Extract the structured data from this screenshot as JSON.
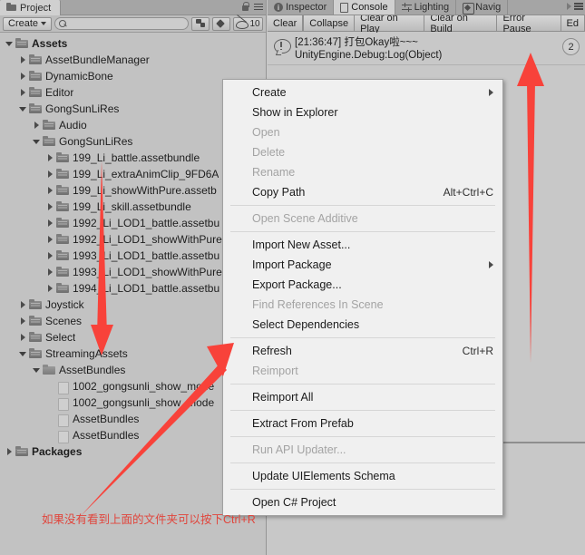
{
  "project_panel": {
    "tab_label": "Project",
    "tab_icon": "folder-icon",
    "lock_icon": "lock-icon",
    "menu_icon": "hamburger-menu-icon",
    "toolbar": {
      "create_label": "Create",
      "create_dropdown_icon": "chevron-down-icon",
      "search_icon": "search-icon",
      "search_value": "",
      "search_placeholder": "",
      "assetbundle_icon": "assetbundle-filter-icon",
      "label_icon": "label-filter-icon",
      "visibility_icon": "hidden-eye-icon",
      "visibility_count": "10"
    },
    "tree": [
      {
        "label": "Assets",
        "indent": 0,
        "expander": "down",
        "icon": "folder",
        "bold": true
      },
      {
        "label": "AssetBundleManager",
        "indent": 1,
        "expander": "right",
        "icon": "folder",
        "bold": false
      },
      {
        "label": "DynamicBone",
        "indent": 1,
        "expander": "right",
        "icon": "folder",
        "bold": false
      },
      {
        "label": "Editor",
        "indent": 1,
        "expander": "right",
        "icon": "folder",
        "bold": false
      },
      {
        "label": "GongSunLiRes",
        "indent": 1,
        "expander": "down",
        "icon": "folder",
        "bold": false
      },
      {
        "label": "Audio",
        "indent": 2,
        "expander": "right",
        "icon": "folder",
        "bold": false
      },
      {
        "label": "GongSunLiRes",
        "indent": 2,
        "expander": "down",
        "icon": "folder",
        "bold": false
      },
      {
        "label": "199_Li_battle.assetbundle",
        "indent": 3,
        "expander": "right",
        "icon": "folder",
        "bold": false
      },
      {
        "label": "199_Li_extraAnimClip_9FD6A",
        "indent": 3,
        "expander": "right",
        "icon": "folder",
        "bold": false
      },
      {
        "label": "199_Li_showWithPure.assetb",
        "indent": 3,
        "expander": "right",
        "icon": "folder",
        "bold": false
      },
      {
        "label": "199_Li_skill.assetbundle",
        "indent": 3,
        "expander": "right",
        "icon": "folder",
        "bold": false
      },
      {
        "label": "1992_Li_LOD1_battle.assetbu",
        "indent": 3,
        "expander": "right",
        "icon": "folder",
        "bold": false
      },
      {
        "label": "1992_Li_LOD1_showWithPure",
        "indent": 3,
        "expander": "right",
        "icon": "folder",
        "bold": false
      },
      {
        "label": "1993_Li_LOD1_battle.assetbu",
        "indent": 3,
        "expander": "right",
        "icon": "folder",
        "bold": false
      },
      {
        "label": "1993_Li_LOD1_showWithPure",
        "indent": 3,
        "expander": "right",
        "icon": "folder",
        "bold": false
      },
      {
        "label": "1994_Li_LOD1_battle.assetbu",
        "indent": 3,
        "expander": "right",
        "icon": "folder",
        "bold": false
      },
      {
        "label": "Joystick",
        "indent": 1,
        "expander": "right",
        "icon": "folder",
        "bold": false
      },
      {
        "label": "Scenes",
        "indent": 1,
        "expander": "right",
        "icon": "folder",
        "bold": false
      },
      {
        "label": "Select",
        "indent": 1,
        "expander": "right",
        "icon": "folder",
        "bold": false
      },
      {
        "label": "StreamingAssets",
        "indent": 1,
        "expander": "down",
        "icon": "folder",
        "bold": false
      },
      {
        "label": "AssetBundles",
        "indent": 2,
        "expander": "down",
        "icon": "folder-open",
        "bold": false
      },
      {
        "label": "1002_gongsunli_show_mode",
        "indent": 3,
        "expander": "none",
        "icon": "file",
        "bold": false
      },
      {
        "label": "1002_gongsunli_show_mode",
        "indent": 3,
        "expander": "none",
        "icon": "file",
        "bold": false
      },
      {
        "label": "AssetBundles",
        "indent": 3,
        "expander": "none",
        "icon": "file",
        "bold": false
      },
      {
        "label": "AssetBundles",
        "indent": 3,
        "expander": "none",
        "icon": "file",
        "bold": false
      },
      {
        "label": "Packages",
        "indent": 0,
        "expander": "right",
        "icon": "folder",
        "bold": true
      }
    ]
  },
  "console_panel": {
    "tabs": [
      {
        "label": "Inspector",
        "icon": "info-icon",
        "active": false
      },
      {
        "label": "Console",
        "icon": "console-doc-icon",
        "active": true
      },
      {
        "label": "Lighting",
        "icon": "lighting-sliders-icon",
        "active": false
      },
      {
        "label": "Navig",
        "icon": "navigation-icon",
        "active": false
      }
    ],
    "overflow_icon": "chevron-right-icon",
    "menu_icon": "hamburger-menu-icon",
    "buttons": [
      {
        "label": "Clear"
      },
      {
        "label": "Collapse"
      },
      {
        "label": "Clear on Play"
      },
      {
        "label": "Clear on Build"
      },
      {
        "label": "Error Pause"
      },
      {
        "label": "Ed"
      }
    ],
    "log": {
      "icon": "info-log-icon",
      "line1": "[21:36:47] 打包Okay啦~~~",
      "line2": "UnityEngine.Debug:Log(Object)",
      "count_badge": "2"
    }
  },
  "context_menu": {
    "items": [
      {
        "label": "Create",
        "disabled": false,
        "submenu": true,
        "shortcut": "",
        "sep_after": false
      },
      {
        "label": "Show in Explorer",
        "disabled": false,
        "submenu": false,
        "shortcut": "",
        "sep_after": false
      },
      {
        "label": "Open",
        "disabled": true,
        "submenu": false,
        "shortcut": "",
        "sep_after": false
      },
      {
        "label": "Delete",
        "disabled": true,
        "submenu": false,
        "shortcut": "",
        "sep_after": false
      },
      {
        "label": "Rename",
        "disabled": true,
        "submenu": false,
        "shortcut": "",
        "sep_after": false
      },
      {
        "label": "Copy Path",
        "disabled": false,
        "submenu": false,
        "shortcut": "Alt+Ctrl+C",
        "sep_after": true
      },
      {
        "label": "Open Scene Additive",
        "disabled": true,
        "submenu": false,
        "shortcut": "",
        "sep_after": true
      },
      {
        "label": "Import New Asset...",
        "disabled": false,
        "submenu": false,
        "shortcut": "",
        "sep_after": false
      },
      {
        "label": "Import Package",
        "disabled": false,
        "submenu": true,
        "shortcut": "",
        "sep_after": false
      },
      {
        "label": "Export Package...",
        "disabled": false,
        "submenu": false,
        "shortcut": "",
        "sep_after": false
      },
      {
        "label": "Find References In Scene",
        "disabled": true,
        "submenu": false,
        "shortcut": "",
        "sep_after": false
      },
      {
        "label": "Select Dependencies",
        "disabled": false,
        "submenu": false,
        "shortcut": "",
        "sep_after": true
      },
      {
        "label": "Refresh",
        "disabled": false,
        "submenu": false,
        "shortcut": "Ctrl+R",
        "sep_after": false
      },
      {
        "label": "Reimport",
        "disabled": true,
        "submenu": false,
        "shortcut": "",
        "sep_after": true
      },
      {
        "label": "Reimport All",
        "disabled": false,
        "submenu": false,
        "shortcut": "",
        "sep_after": true
      },
      {
        "label": "Extract From Prefab",
        "disabled": false,
        "submenu": false,
        "shortcut": "",
        "sep_after": true
      },
      {
        "label": "Run API Updater...",
        "disabled": true,
        "submenu": false,
        "shortcut": "",
        "sep_after": true
      },
      {
        "label": "Update UIElements Schema",
        "disabled": false,
        "submenu": false,
        "shortcut": "",
        "sep_after": true
      },
      {
        "label": "Open C# Project",
        "disabled": false,
        "submenu": false,
        "shortcut": "",
        "sep_after": false
      }
    ]
  },
  "annotations": {
    "red_note": "如果没有看到上面的文件夹可以按下Ctrl+R",
    "red_color": "#e0453c",
    "arrows": [
      {
        "name": "down-arrow-to-assetbundles",
        "direction": "down"
      },
      {
        "name": "diagonal-arrow-to-refresh",
        "direction": "up-right"
      },
      {
        "name": "vertical-arrow-to-console",
        "direction": "up"
      }
    ]
  }
}
